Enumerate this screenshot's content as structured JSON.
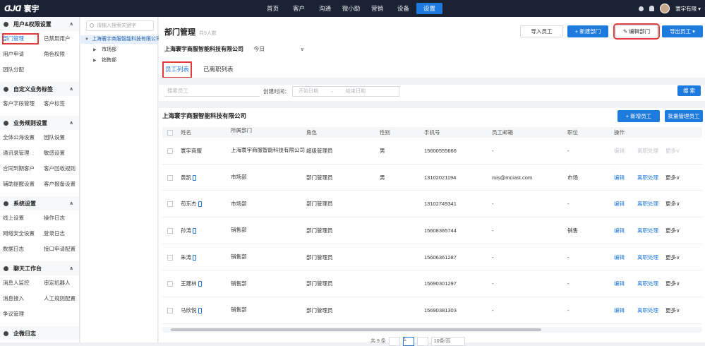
{
  "topbar": {
    "logo_mark": "ᗡᒍᗡ",
    "logo_text": "寰宇",
    "nav": [
      "首页",
      "客户",
      "沟通",
      "微小助",
      "营销",
      "设备",
      "设置"
    ],
    "active_nav": "设置",
    "user_name": "寰宇有限 ▾"
  },
  "sidebar": {
    "sections": [
      {
        "title": "用户&权限设置",
        "items": [
          "部门管理",
          "已禁用用户",
          "用户申请",
          "角色权限",
          "团队分配"
        ]
      },
      {
        "title": "自定义业务标签",
        "items": [
          "客户字段管理",
          "客户标签"
        ]
      },
      {
        "title": "业务规则设置",
        "items": [
          "全体公海设置",
          "团队设置",
          "通讯录管理",
          "敏感设置",
          "合同到期客户",
          "客户回收规则",
          "辅助提醒设置",
          "客户报备设置"
        ]
      },
      {
        "title": "系统设置",
        "items": [
          "线上设置",
          "操作日志",
          "网络安全设置",
          "登录日志",
          "数据日志",
          "接口申请配置"
        ]
      },
      {
        "title": "聊天工作台",
        "items": [
          "消息人监控",
          "审定机器人",
          "消息接入",
          "人工规则配置",
          "争议管理"
        ]
      },
      {
        "title": "企微日志",
        "items": []
      }
    ],
    "selected": "部门管理"
  },
  "tree": {
    "search_placeholder": "请输入搜索关键字",
    "root": "上海寰宇商服智能科技有限公司",
    "children": [
      "市场部",
      "销售部"
    ]
  },
  "page": {
    "title": "部门管理",
    "subtitle": "共9人数",
    "company": "上海寰宇商服智能科技有限公司",
    "level": "今日",
    "import_btn": "导入员工",
    "new_dept_btn": "+ 新建部门",
    "edit_dept_btn": "✎ 编辑部门",
    "export_btn": "导出员工 ▾",
    "tabs": [
      "员工列表",
      "已离职列表"
    ],
    "active_tab": "员工列表",
    "search_placeholder": "搜索员工",
    "date_label": "创建时间：",
    "date_start": "开始日期",
    "date_end": "结束日期",
    "search_btn": "搜 索",
    "org_name": "上海寰宇商服智能科技有限公司",
    "add_member_btn": "+ 新增员工",
    "manage_btn": "批量管理员工"
  },
  "table": {
    "columns": [
      "姓名",
      "所属部门",
      "角色",
      "性别",
      "手机号",
      "员工邮箱",
      "职位",
      "操作"
    ],
    "rows": [
      {
        "name": "寰宇商服",
        "dept": "上海寰宇商服智能科技有限公司",
        "role": "超级管理员",
        "gender": "男",
        "phone": "15600555666",
        "email": "-",
        "position": "-",
        "phone_icon": false,
        "actions": [
          "编辑",
          "离职处理",
          "更多∨"
        ],
        "disabled": true
      },
      {
        "name": "黄凯",
        "dept": "市场部",
        "role": "部门管理员",
        "gender": "男",
        "phone": "13102021194",
        "email": "mis@mciast.com",
        "position": "市场",
        "phone_icon": true,
        "actions": [
          "编辑",
          "离职处理",
          "更多∨"
        ],
        "disabled": false
      },
      {
        "name": "苟东杰",
        "dept": "市场部",
        "role": "部门管理员",
        "gender": "",
        "phone": "13102749341",
        "email": "-",
        "position": "-",
        "phone_icon": true,
        "actions": [
          "编辑",
          "离职处理",
          "更多∨"
        ],
        "disabled": false
      },
      {
        "name": "孙涛",
        "dept": "销售部",
        "role": "部门管理员",
        "gender": "",
        "phone": "15608365744",
        "email": "-",
        "position": "销售",
        "phone_icon": true,
        "actions": [
          "编辑",
          "离职处理",
          "更多∨"
        ],
        "disabled": false
      },
      {
        "name": "朱涛",
        "dept": "销售部",
        "role": "部门管理员",
        "gender": "",
        "phone": "15606361287",
        "email": "-",
        "position": "-",
        "phone_icon": true,
        "actions": [
          "编辑",
          "离职处理",
          "更多∨"
        ],
        "disabled": false
      },
      {
        "name": "王建林",
        "dept": "销售部",
        "role": "部门管理员",
        "gender": "",
        "phone": "15690301297",
        "email": "-",
        "position": "-",
        "phone_icon": true,
        "actions": [
          "编辑",
          "离职处理",
          "更多∨"
        ],
        "disabled": false
      },
      {
        "name": "马欣悦",
        "dept": "销售部",
        "role": "部门管理员",
        "gender": "",
        "phone": "15690381303",
        "email": "-",
        "position": "-",
        "phone_icon": true,
        "actions": [
          "编辑",
          "离职处理",
          "更多∨"
        ],
        "disabled": false
      }
    ]
  },
  "pager": {
    "total": "共 9 条",
    "page": "1",
    "page_size": "10条/页"
  }
}
